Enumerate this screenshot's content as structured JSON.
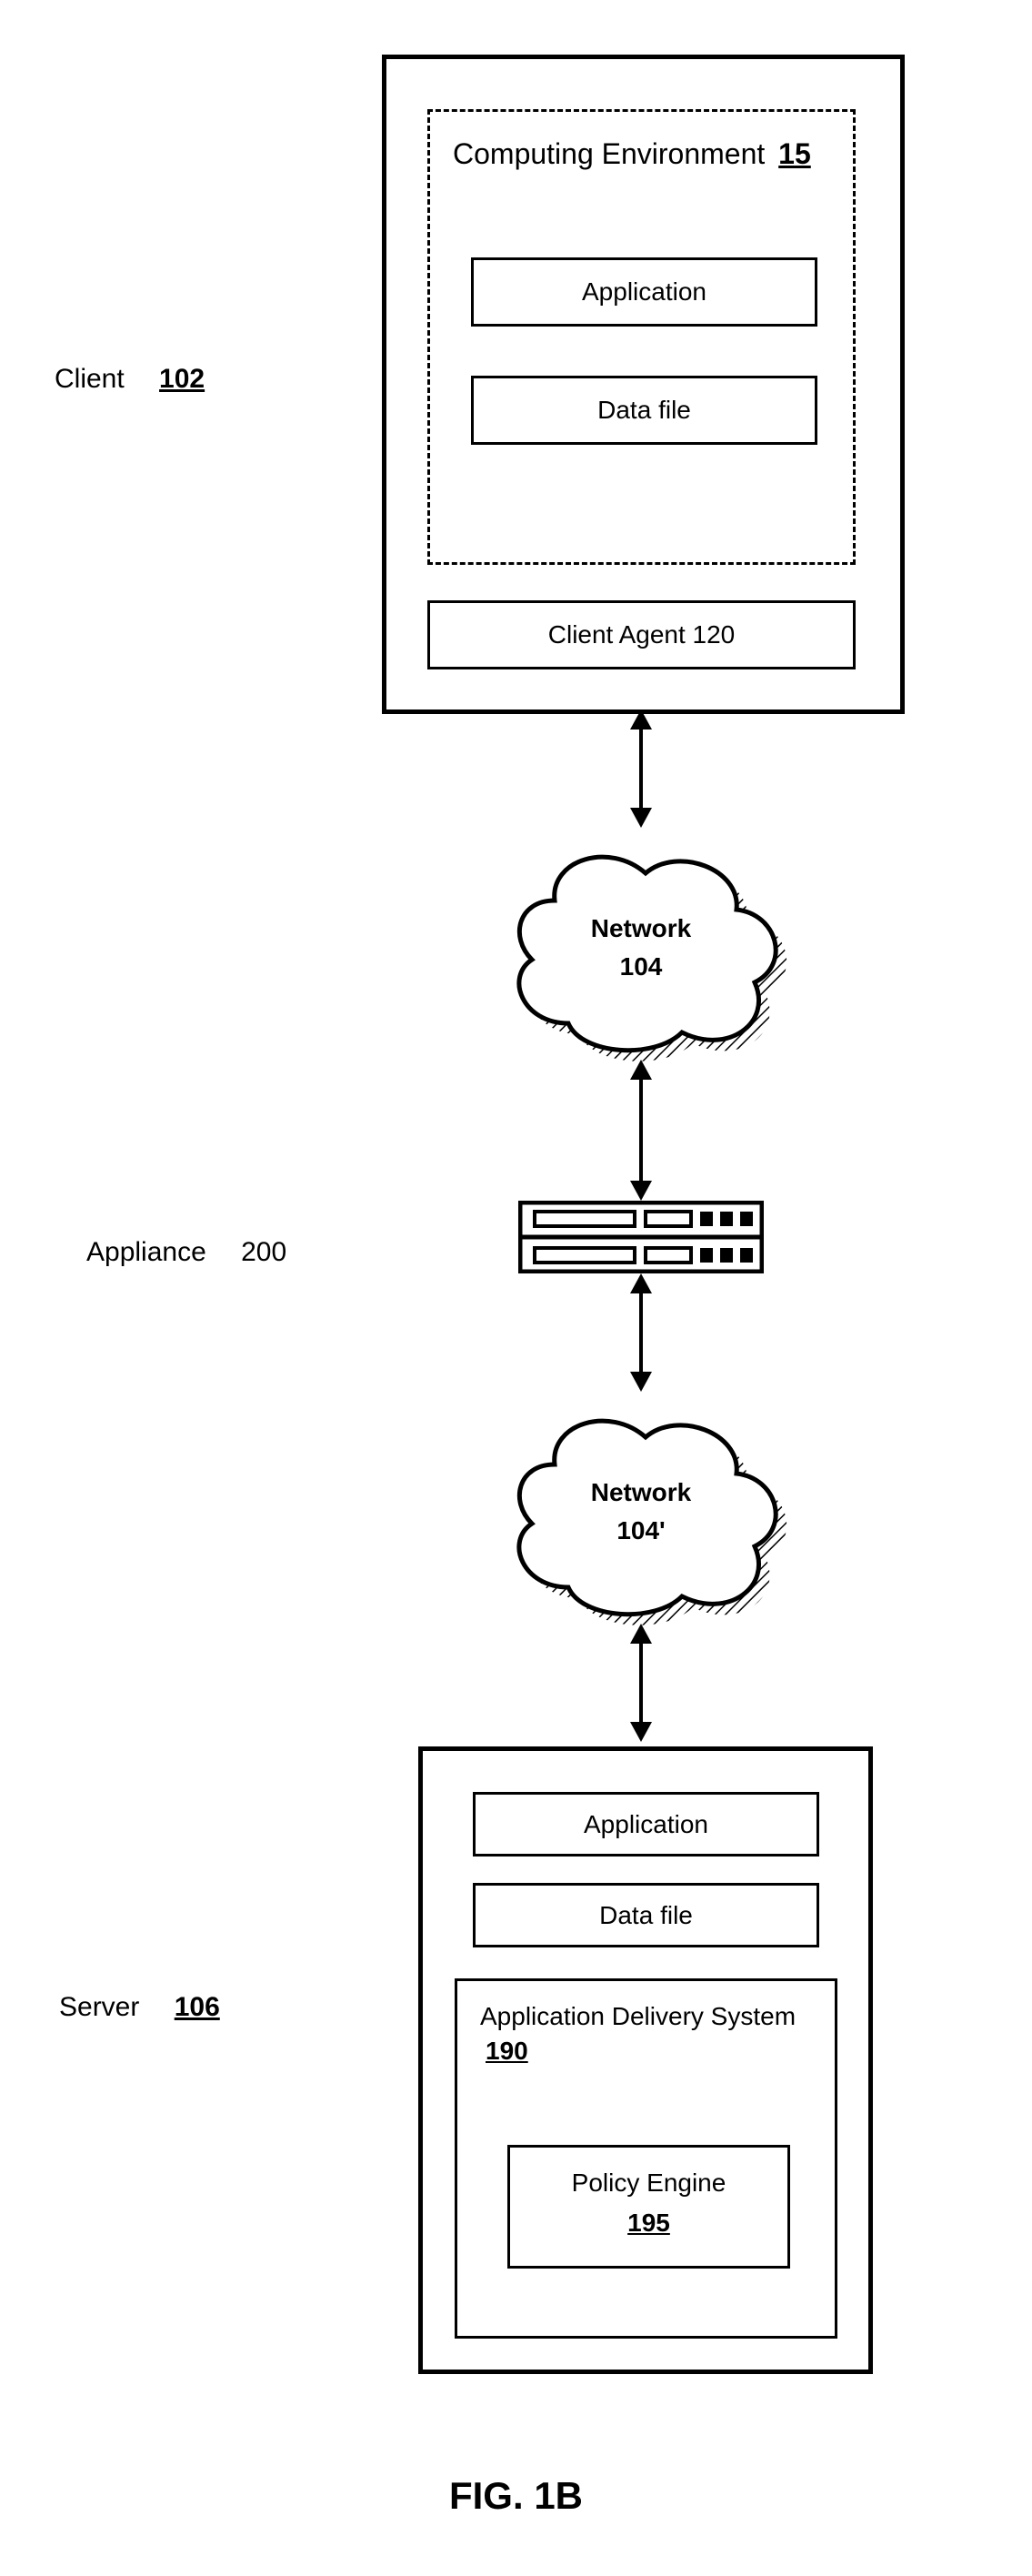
{
  "labels": {
    "client": {
      "name": "Client",
      "num": "102"
    },
    "appliance": {
      "name": "Appliance",
      "num": "200"
    },
    "server": {
      "name": "Server",
      "num": "106"
    }
  },
  "client_box": {
    "env_label": "Computing Environment",
    "env_num": "15",
    "application": "Application",
    "data_file": "Data file",
    "agent": "Client Agent 120"
  },
  "network1": {
    "label": "Network",
    "num": "104"
  },
  "network2": {
    "label": "Network",
    "num": "104'"
  },
  "server_box": {
    "application": "Application",
    "data_file": "Data file",
    "ads_label": "Application Delivery System",
    "ads_num": "190",
    "policy_label": "Policy Engine",
    "policy_num": "195"
  },
  "figure_caption": "FIG. 1B"
}
